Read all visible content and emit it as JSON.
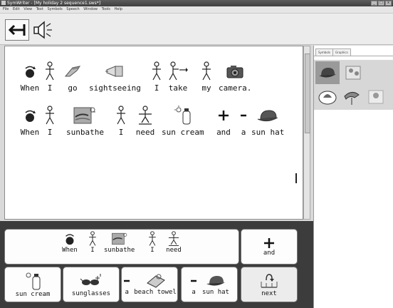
{
  "window": {
    "title": "SymWriter - [My holiday 2 sequence1.sws*]",
    "controls": [
      "_",
      "□",
      "x"
    ]
  },
  "menubar": [
    "File",
    "Edit",
    "View",
    "Text",
    "Symbols",
    "Speech",
    "Window",
    "Tools",
    "Help"
  ],
  "toolbar": {
    "back_icon": "back-arrow-icon",
    "speak_icon": "speaker-icon"
  },
  "document": {
    "line1": [
      "When",
      "I",
      "go",
      "sightseeing",
      "I",
      "take",
      "my",
      "camera."
    ],
    "line2": [
      "When",
      "I",
      "sunbathe",
      "I",
      "need",
      "sun cream",
      "and",
      "a",
      "sun hat"
    ]
  },
  "side_panel": {
    "tabs": [
      "Symbols",
      "Graphics"
    ],
    "icons": [
      "sun-hat-icon",
      "sun-hat-people-icon",
      "wide-brim-hat-icon",
      "bird-hat-icon",
      "hat-figure-icon"
    ]
  },
  "grid": {
    "sentence": [
      "When",
      "I",
      "sunbathe",
      "I",
      "need"
    ],
    "and_label": "and",
    "and_symbol": "+",
    "cells": [
      "sun cream",
      "sunglasses",
      "a",
      "beach towel",
      "a",
      "sun hat"
    ],
    "next_label": "next"
  }
}
